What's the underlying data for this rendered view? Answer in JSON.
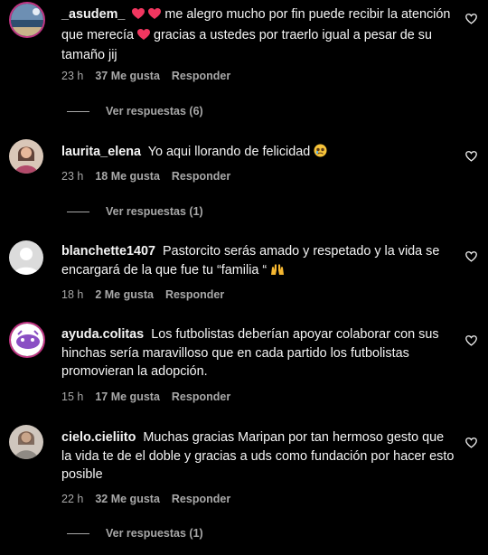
{
  "colors": {
    "background": "#000000",
    "text": "#f5f5f5",
    "muted": "#a8a8a8",
    "heart_emoji": "#f0365f"
  },
  "comments": [
    {
      "username": "_asudem_",
      "text_part1": "me alegro mucho por fin puede recibir la atención que merecía",
      "text_part2": "gracias a ustedes por traerlo igual a pesar de su tamaño jij",
      "emojis": [
        "red-heart-emoji",
        "red-heart-emoji",
        "red-heart-emoji"
      ],
      "time": "23 h",
      "likes": "37 Me gusta",
      "reply": "Responder",
      "view_replies": "Ver respuestas (6)"
    },
    {
      "username": "laurita_elena",
      "text": "Yo aqui llorando de felicidad",
      "emojis": [
        "teary-face-emoji"
      ],
      "time": "23 h",
      "likes": "18 Me gusta",
      "reply": "Responder",
      "view_replies": "Ver respuestas (1)"
    },
    {
      "username": "blanchette1407",
      "text": "Pastorcito serás amado y respetado y la vida se encargará de la que fue tu “familia “",
      "emojis": [
        "raised-hands-emoji"
      ],
      "time": "18 h",
      "likes": "2 Me gusta",
      "reply": "Responder"
    },
    {
      "username": "ayuda.colitas",
      "text": "Los futbolistas deberían apoyar colaborar con sus hinchas sería maravilloso que en cada partido los futbolistas promovieran la adopción.",
      "time": "15 h",
      "likes": "17 Me gusta",
      "reply": "Responder"
    },
    {
      "username": "cielo.cieliito",
      "text": "Muchas gracias Maripan por tan hermoso gesto que la vida te de el doble y gracias a uds como fundación por hacer esto posible",
      "time": "22 h",
      "likes": "32 Me gusta",
      "reply": "Responder",
      "view_replies": "Ver respuestas (1)"
    }
  ]
}
